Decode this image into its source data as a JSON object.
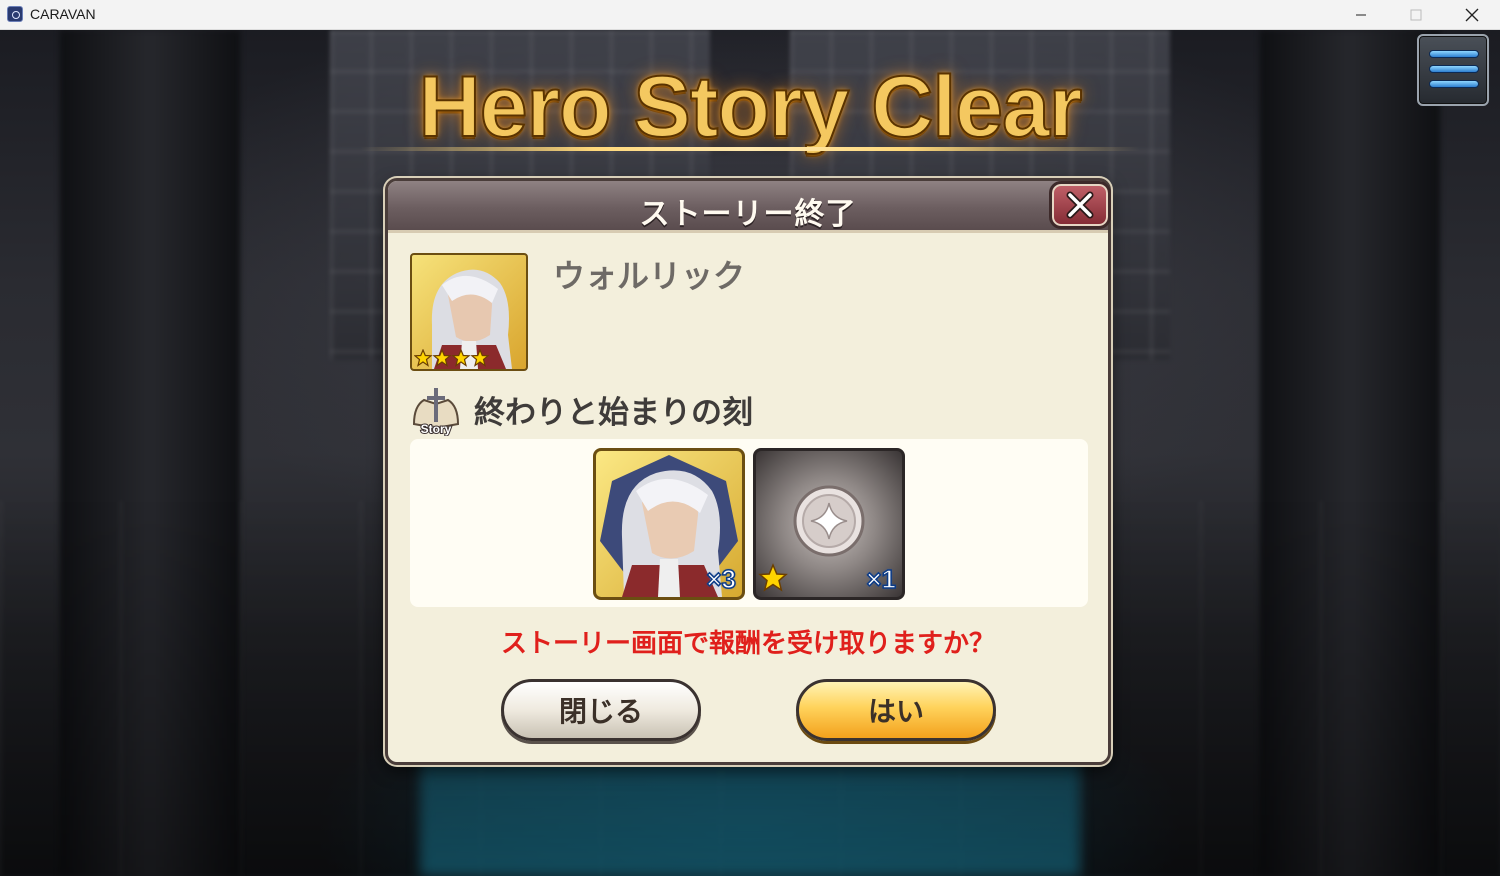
{
  "window": {
    "title": "CARAVAN",
    "controls": [
      "minimize",
      "maximize",
      "close"
    ]
  },
  "game": {
    "title_banner": "Hero Story Clear",
    "menu_icon": "hamburger-menu-icon"
  },
  "dialog": {
    "title": "ストーリー終了",
    "close_icon": "close-icon",
    "hero": {
      "name": "ウォルリック",
      "stars": 4
    },
    "story": {
      "icon_label": "Story",
      "name": "終わりと始まりの刻"
    },
    "rewards": [
      {
        "icon": "hero-portrait-icon",
        "quantity": "×3"
      },
      {
        "icon": "silver-medal-icon",
        "stars": 1,
        "quantity": "×1"
      }
    ],
    "prompt": "ストーリー画面で報酬を受け取りますか？",
    "buttons": {
      "close": "閉じる",
      "yes": "はい"
    }
  },
  "colors": {
    "title_gold": "#f4c860",
    "prompt_red": "#e0201c",
    "dialog_bg": "#f3efdc",
    "yes_button": "#ffd35c"
  }
}
